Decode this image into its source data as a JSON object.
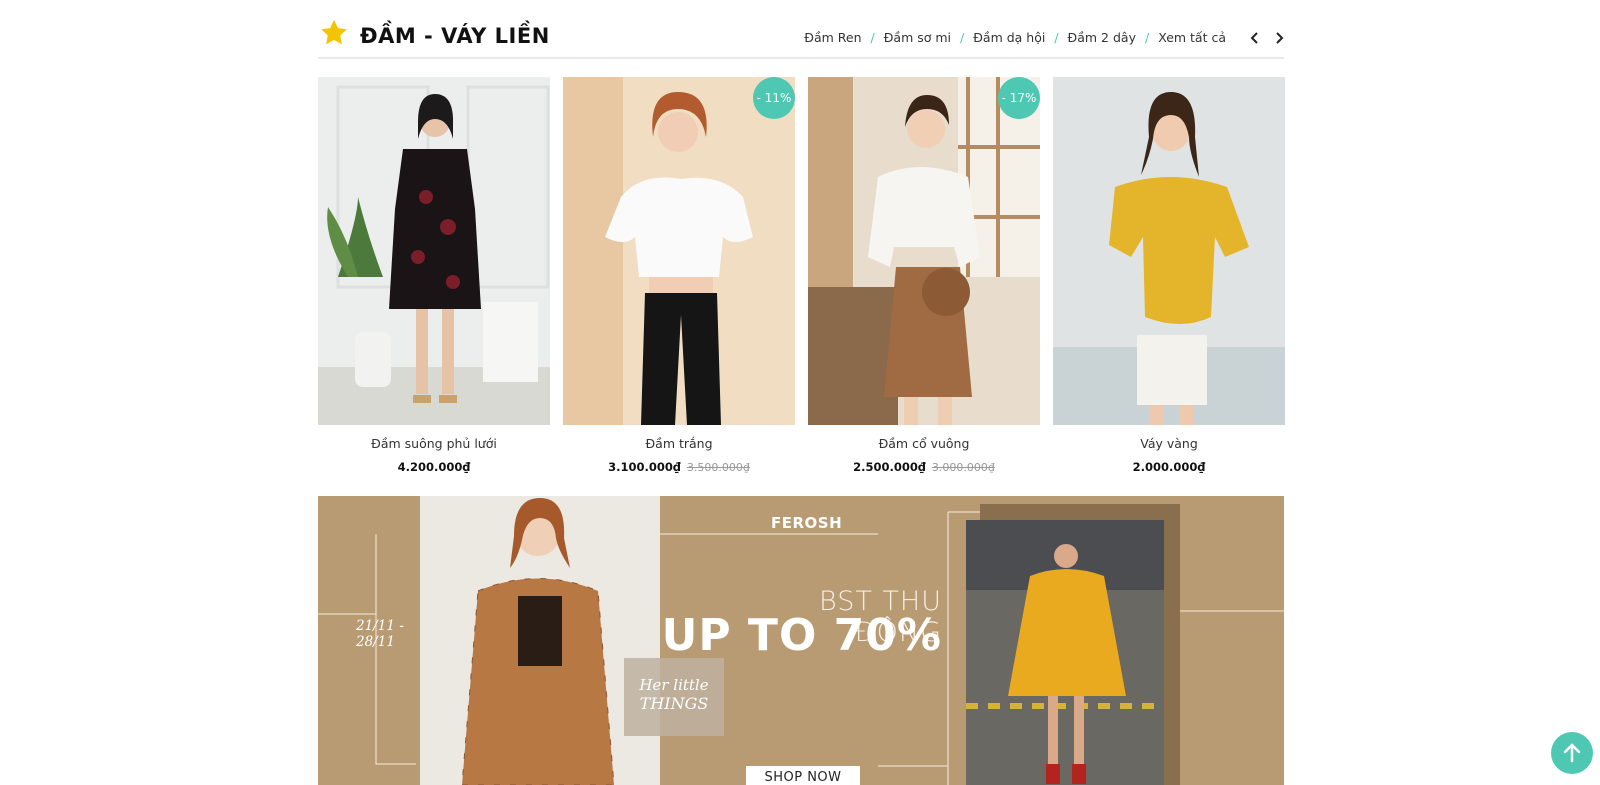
{
  "section": {
    "title": "ĐẦM - VÁY LIỀN",
    "links": [
      "Đầm Ren",
      "Đầm sơ mi",
      "Đầm dạ hội",
      "Đầm 2 dây",
      "Xem tất cả"
    ],
    "separator": "/"
  },
  "products": [
    {
      "name": "Đầm suông phủ lưới",
      "price": "4.200.000₫",
      "old_price": "",
      "badge": ""
    },
    {
      "name": "Đầm trắng",
      "price": "3.100.000₫",
      "old_price": "3.500.000₫",
      "badge": "- 11%"
    },
    {
      "name": "Đầm cổ vuông",
      "price": "2.500.000₫",
      "old_price": "3.000.000₫",
      "badge": "- 17%"
    },
    {
      "name": "Váy vàng",
      "price": "2.000.000₫",
      "old_price": "",
      "badge": ""
    }
  ],
  "banner": {
    "brand": "FEROSH",
    "headline": "BST THU ĐÔNG",
    "promo": "UP TO 70%",
    "dates_line1": "21/11 -",
    "dates_line2": "28/11",
    "tagline_line1": "Her little",
    "tagline_line2": "THINGS",
    "cta": "SHOP NOW"
  },
  "colors": {
    "accent": "#4ec8b3",
    "banner_bg": "#b89b72",
    "star": "#f5c400"
  },
  "icons": {
    "title": "star-icon",
    "prev": "chevron-left-icon",
    "next": "chevron-right-icon",
    "back_to_top": "arrow-up-icon"
  }
}
